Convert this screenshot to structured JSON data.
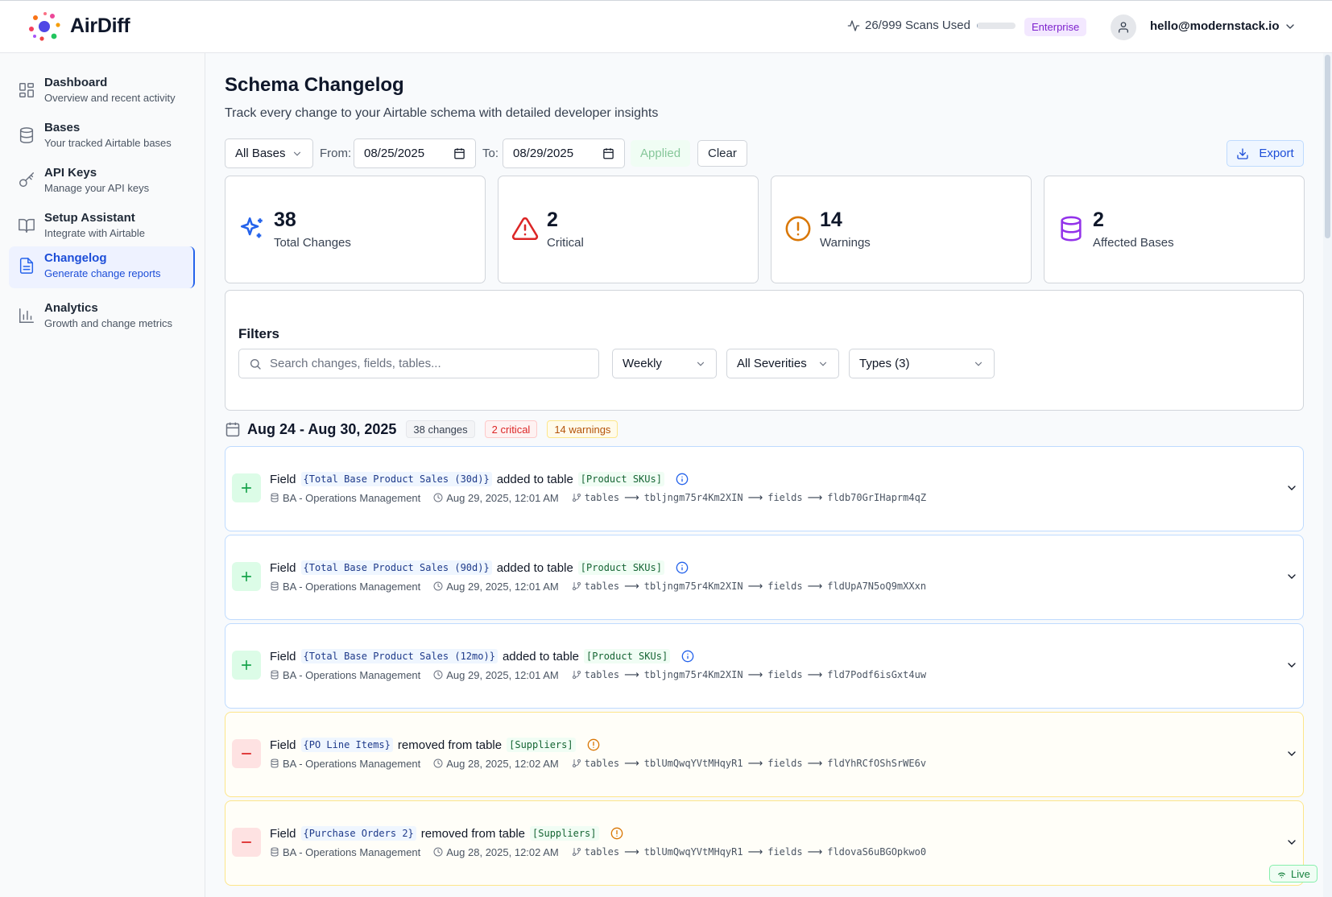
{
  "app": {
    "title": "AirDiff"
  },
  "header": {
    "scans_label": "26/999 Scans Used",
    "scans_used_fraction": 0.026,
    "plan": "Enterprise",
    "user_email": "hello@modernstack.io"
  },
  "sidebar": {
    "items": [
      {
        "label": "Dashboard",
        "sub": "Overview and recent activity",
        "icon": "dashboard-grid-icon",
        "active": false
      },
      {
        "label": "Bases",
        "sub": "Your tracked Airtable bases",
        "icon": "database-icon",
        "active": false
      },
      {
        "label": "API Keys",
        "sub": "Manage your API keys",
        "icon": "key-icon",
        "active": false
      },
      {
        "label": "Setup Assistant",
        "sub": "Integrate with Airtable",
        "icon": "book-open-icon",
        "active": false
      },
      {
        "label": "Changelog",
        "sub": "Generate change reports",
        "icon": "file-text-icon",
        "active": true
      },
      {
        "label": "Analytics",
        "sub": "Growth and change metrics",
        "icon": "bar-chart-icon",
        "active": false
      }
    ]
  },
  "main": {
    "title": "Schema Changelog",
    "subtitle": "Track every change to your Airtable schema with detailed developer insights",
    "controls": {
      "base_select": "All Bases",
      "from_label": "From:",
      "from_date": "08/25/2025",
      "to_label": "To:",
      "to_date": "08/29/2025",
      "applied_label": "Applied",
      "clear_label": "Clear",
      "export_label": "Export"
    },
    "stats": [
      {
        "value": "38",
        "label": "Total Changes",
        "icon": "sparkles-icon",
        "color": "#2563eb"
      },
      {
        "value": "2",
        "label": "Critical",
        "icon": "alert-triangle-icon",
        "color": "#dc2626"
      },
      {
        "value": "14",
        "label": "Warnings",
        "icon": "alert-circle-icon",
        "color": "#d97706"
      },
      {
        "value": "2",
        "label": "Affected Bases",
        "icon": "database-icon",
        "color": "#9333ea"
      }
    ],
    "filters": {
      "title": "Filters",
      "search_placeholder": "Search changes, fields, tables...",
      "period": "Weekly",
      "severity": "All Severities",
      "types": "Types (3)"
    },
    "week": {
      "title": "Aug 24 - Aug 30, 2025",
      "changes_pill": "38 changes",
      "critical_pill": "2 critical",
      "warnings_pill": "14 warnings"
    },
    "changes": [
      {
        "kind": "add",
        "prefix": "Field",
        "field": "{Total Base Product Sales (30d)}",
        "action": "added to table",
        "table": "[Product SKUs]",
        "base": "BA - Operations Management",
        "time": "Aug 29, 2025, 12:01 AM",
        "path_a": "tables",
        "table_id": "tbljngm75r4Km2XIN",
        "path_b": "fields",
        "field_id": "fldb70GrIHaprm4qZ"
      },
      {
        "kind": "add",
        "prefix": "Field",
        "field": "{Total Base Product Sales (90d)}",
        "action": "added to table",
        "table": "[Product SKUs]",
        "base": "BA - Operations Management",
        "time": "Aug 29, 2025, 12:01 AM",
        "path_a": "tables",
        "table_id": "tbljngm75r4Km2XIN",
        "path_b": "fields",
        "field_id": "fldUpA7N5oQ9mXXxn"
      },
      {
        "kind": "add",
        "prefix": "Field",
        "field": "{Total Base Product Sales (12mo)}",
        "action": "added to table",
        "table": "[Product SKUs]",
        "base": "BA - Operations Management",
        "time": "Aug 29, 2025, 12:01 AM",
        "path_a": "tables",
        "table_id": "tbljngm75r4Km2XIN",
        "path_b": "fields",
        "field_id": "fld7Podf6isGxt4uw"
      },
      {
        "kind": "remove",
        "prefix": "Field",
        "field": "{PO Line Items}",
        "action": "removed from table",
        "table": "[Suppliers]",
        "base": "BA - Operations Management",
        "time": "Aug 28, 2025, 12:02 AM",
        "path_a": "tables",
        "table_id": "tblUmQwqYVtMHqyR1",
        "path_b": "fields",
        "field_id": "fldYhRCfOShSrWE6v"
      },
      {
        "kind": "remove",
        "prefix": "Field",
        "field": "{Purchase Orders 2}",
        "action": "removed from table",
        "table": "[Suppliers]",
        "base": "BA - Operations Management",
        "time": "Aug 28, 2025, 12:02 AM",
        "path_a": "tables",
        "table_id": "tblUmQwqYVtMHqyR1",
        "path_b": "fields",
        "field_id": "fldovaS6uBGOpkwo0"
      }
    ],
    "live_label": "Live"
  }
}
